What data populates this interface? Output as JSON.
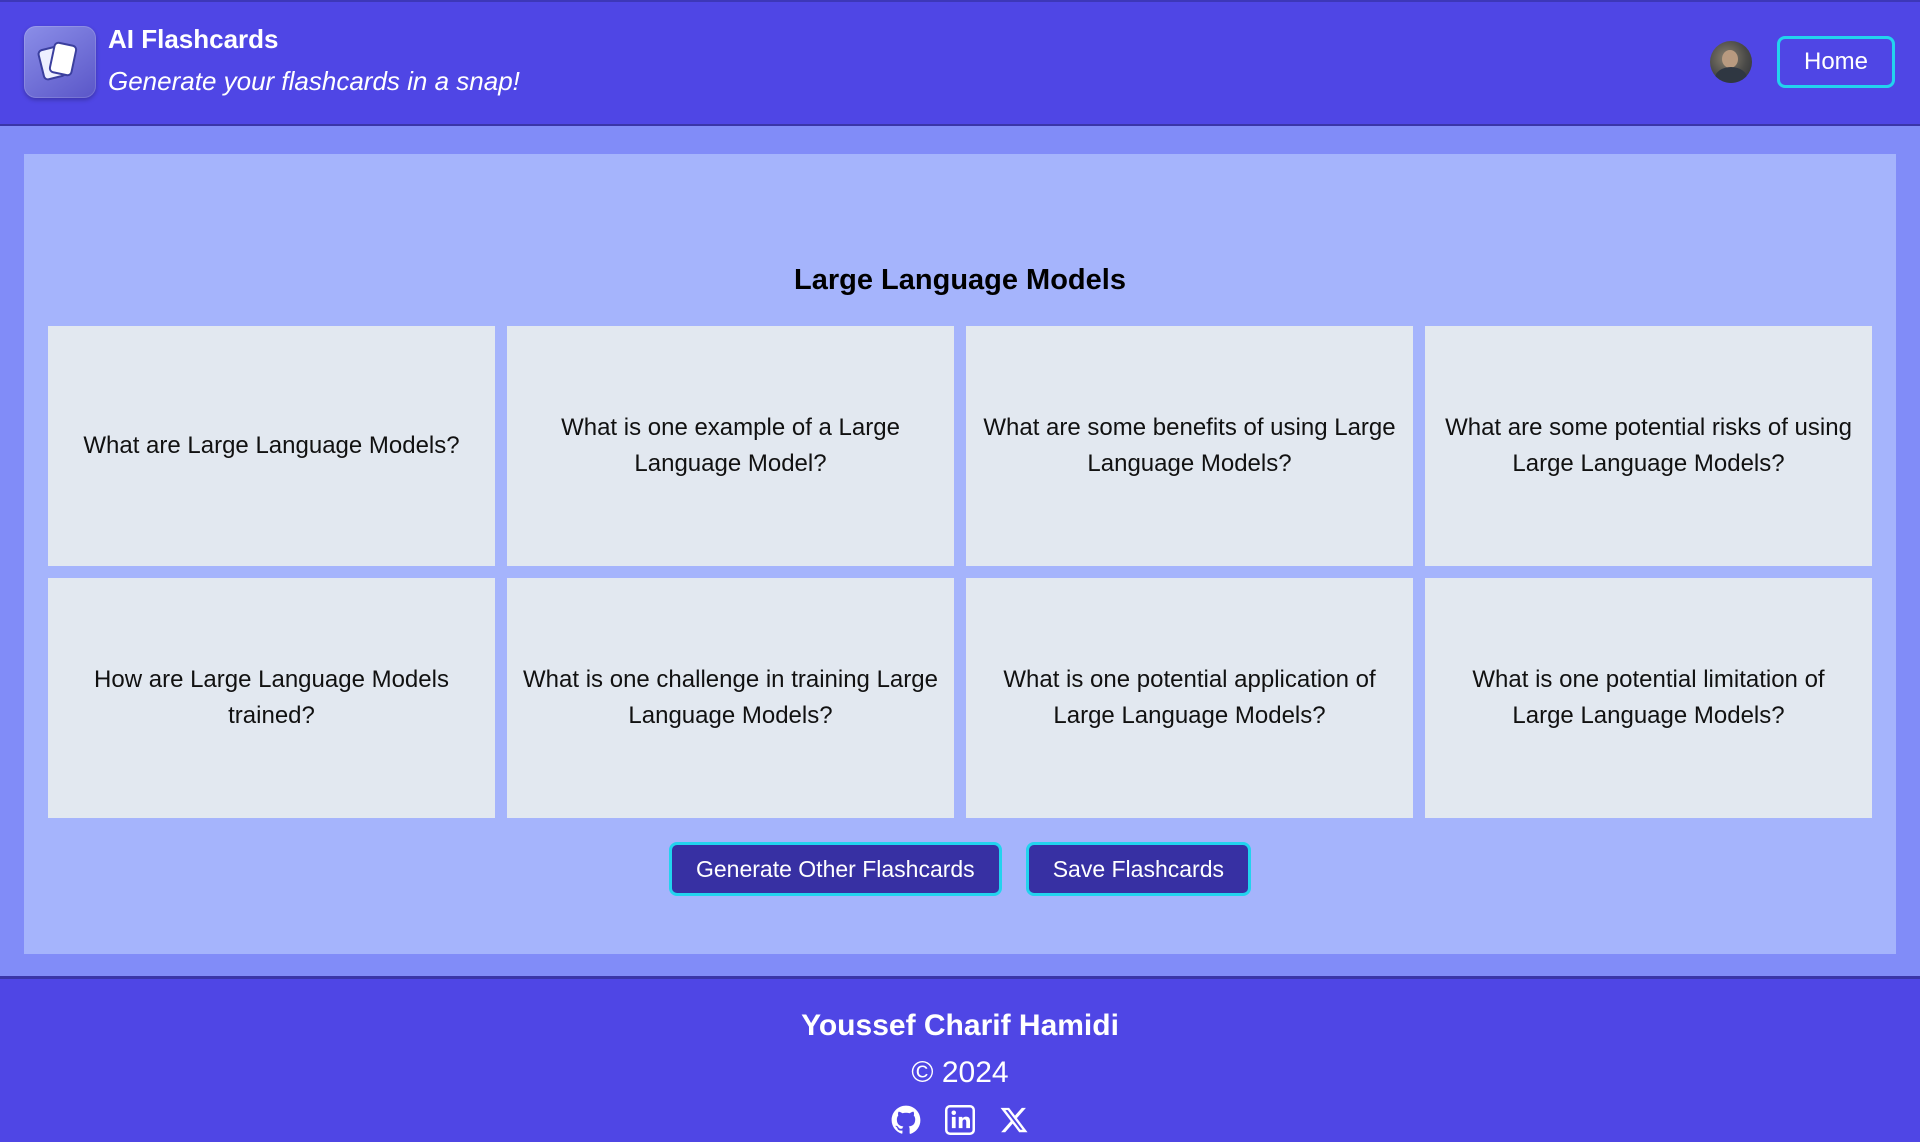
{
  "header": {
    "title": "AI Flashcards",
    "subtitle": "Generate your flashcards in a snap!",
    "home_label": "Home"
  },
  "deck": {
    "title": "Large Language Models",
    "cards": [
      "What are Large Language Models?",
      "What is one example of a Large Language Model?",
      "What are some benefits of using Large Language Models?",
      "What are some potential risks of using Large Language Models?",
      "How are Large Language Models trained?",
      "What is one challenge in training Large Language Models?",
      "What is one potential application of Large Language Models?",
      "What is one potential limitation of Large Language Models?"
    ]
  },
  "actions": {
    "generate_label": "Generate Other Flashcards",
    "save_label": "Save Flashcards"
  },
  "footer": {
    "author": "Youssef Charif Hamidi",
    "copyright": "© 2024",
    "social_icons": [
      "github-icon",
      "linkedin-icon",
      "x-icon"
    ]
  },
  "colors": {
    "header_bg": "#4f46e5",
    "page_bg": "#818cf8",
    "panel_bg": "#a5b4fc",
    "card_bg": "#e2e8f0",
    "button_bg": "#3730a3",
    "button_border": "#22d3ee"
  }
}
